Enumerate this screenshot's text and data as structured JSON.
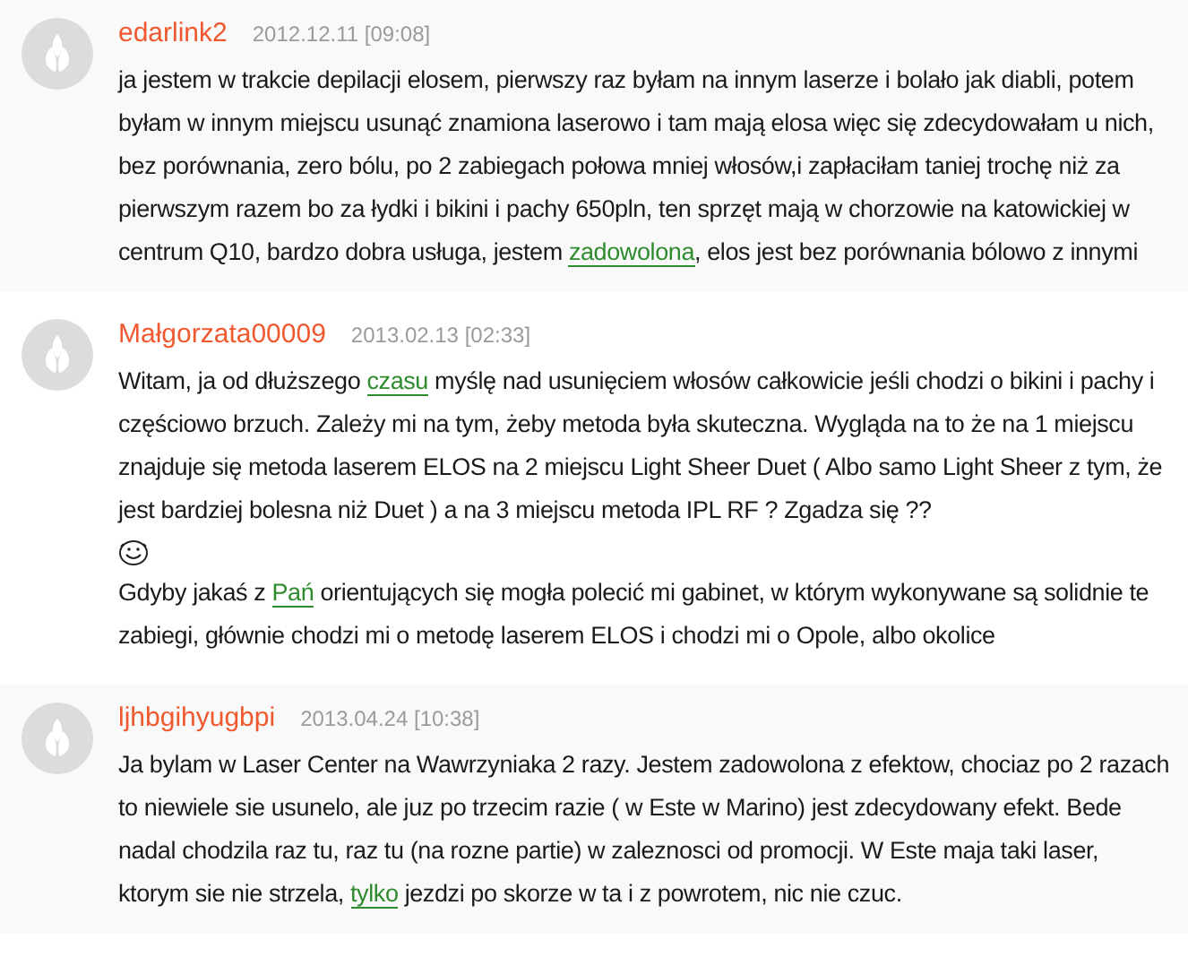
{
  "comments": [
    {
      "author": "edarlink2",
      "date": "2012.12.11",
      "time": "[09:08]",
      "paragraphs": [
        [
          {
            "kind": "text",
            "text": "ja jestem w trakcie depilacji elosem, pierwszy raz byłam na innym laserze i bolało jak diabli, potem byłam w innym miejscu usunąć znamiona laserowo i tam mają elosa więc się zdecydowałam u nich, bez porównania, zero bólu, po 2 zabiegach połowa mniej włosów,i zapłaciłam taniej trochę niż za pierwszym razem bo za łydki i bikini i pachy 650pln, ten sprzęt mają w chorzowie na katowickiej w centrum Q10, bardzo dobra usługa, jestem "
          },
          {
            "kind": "link",
            "text": "zadowolona"
          },
          {
            "kind": "text",
            "text": ", elos jest bez porównania bólowo z innymi"
          }
        ]
      ]
    },
    {
      "author": "Małgorzata00009",
      "date": "2013.02.13",
      "time": "[02:33]",
      "paragraphs": [
        [
          {
            "kind": "text",
            "text": "Witam, ja od dłuższego "
          },
          {
            "kind": "link",
            "text": "czasu"
          },
          {
            "kind": "text",
            "text": " myślę nad usunięciem włosów całkowicie jeśli chodzi o bikini i pachy i częściowo brzuch. Zależy mi na tym, żeby metoda była skuteczna. Wygląda na to że na 1 miejscu znajduje się metoda laserem ELOS na 2 miejscu Light Sheer Duet ( Albo samo Light Sheer z tym, że jest bardziej bolesna niż Duet ) a na 3 miejscu metoda IPL RF ? Zgadza się ??"
          }
        ],
        [
          {
            "kind": "smiley"
          }
        ],
        [
          {
            "kind": "text",
            "text": "Gdyby jakaś z "
          },
          {
            "kind": "link",
            "text": "Pań"
          },
          {
            "kind": "text",
            "text": " orientujących się mogła polecić mi gabinet, w którym wykonywane są solidnie te zabiegi, głównie chodzi mi o metodę laserem ELOS i chodzi mi o Opole, albo okolice"
          }
        ]
      ]
    },
    {
      "author": "ljhbgihyugbpi",
      "date": "2013.04.24",
      "time": "[10:38]",
      "paragraphs": [
        [
          {
            "kind": "text",
            "text": "Ja bylam w Laser Center na Wawrzyniaka 2 razy. Jestem zadowolona z efektow, chociaz po 2 razach to niewiele sie usunelo, ale juz po trzecim razie ( w Este w Marino) jest zdecydowany efekt. Bede nadal chodzila raz tu, raz tu (na rozne partie) w zaleznosci od promocji. W Este maja taki laser, ktorym sie nie strzela, "
          },
          {
            "kind": "link",
            "text": "tylko"
          },
          {
            "kind": "text",
            "text": " jezdzi po skorze w ta i z powrotem, nic nie czuc."
          }
        ]
      ]
    }
  ]
}
